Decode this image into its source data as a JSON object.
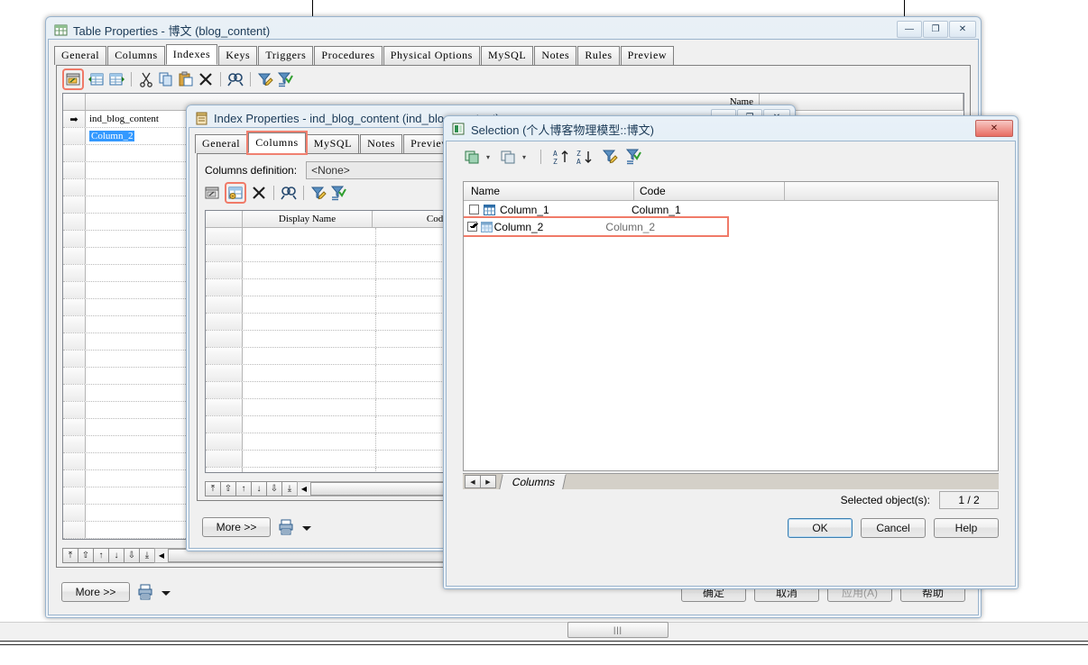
{
  "table_properties": {
    "title": "Table Properties - 博文 (blog_content)",
    "window_icon": "table-icon",
    "buttons": {
      "minimize": "—",
      "maximize": "❐",
      "close": "✕"
    },
    "tabs": [
      {
        "label": "General",
        "active": false
      },
      {
        "label": "Columns",
        "active": false
      },
      {
        "label": "Indexes",
        "active": true
      },
      {
        "label": "Keys",
        "active": false
      },
      {
        "label": "Triggers",
        "active": false
      },
      {
        "label": "Procedures",
        "active": false
      },
      {
        "label": "Physical Options",
        "active": false
      },
      {
        "label": "MySQL",
        "active": false
      },
      {
        "label": "Notes",
        "active": false
      },
      {
        "label": "Rules",
        "active": false
      },
      {
        "label": "Preview",
        "active": false
      }
    ],
    "toolbar": [
      {
        "name": "properties-icon",
        "highlighted": true
      },
      {
        "name": "insert-row-icon",
        "highlighted": false
      },
      {
        "name": "add-row-icon",
        "highlighted": false
      },
      {
        "name": "cut-icon",
        "highlighted": false
      },
      {
        "name": "copy-icon",
        "highlighted": false
      },
      {
        "name": "paste-icon",
        "highlighted": false
      },
      {
        "name": "delete-icon",
        "highlighted": false
      },
      {
        "name": "find-icon",
        "highlighted": false
      },
      {
        "name": "filter-edit-icon",
        "highlighted": false
      },
      {
        "name": "filter-apply-icon",
        "highlighted": false
      }
    ],
    "grid": {
      "columns": [
        "Name"
      ],
      "rows": [
        {
          "marker": "➡",
          "name": "ind_blog_content"
        },
        {
          "marker": "",
          "name": ""
        },
        {
          "marker": "",
          "name": ""
        },
        {
          "marker": "",
          "name": ""
        },
        {
          "marker": "",
          "name": ""
        },
        {
          "marker": "",
          "name": ""
        },
        {
          "marker": "",
          "name": ""
        },
        {
          "marker": "",
          "name": ""
        },
        {
          "marker": "",
          "name": ""
        },
        {
          "marker": "",
          "name": ""
        },
        {
          "marker": "",
          "name": ""
        },
        {
          "marker": "",
          "name": ""
        },
        {
          "marker": "",
          "name": ""
        },
        {
          "marker": "",
          "name": ""
        },
        {
          "marker": "",
          "name": ""
        },
        {
          "marker": "",
          "name": ""
        },
        {
          "marker": "",
          "name": ""
        },
        {
          "marker": "",
          "name": ""
        },
        {
          "marker": "",
          "name": ""
        },
        {
          "marker": "",
          "name": ""
        },
        {
          "marker": "",
          "name": ""
        },
        {
          "marker": "",
          "name": ""
        },
        {
          "marker": "",
          "name": ""
        },
        {
          "marker": "",
          "name": ""
        },
        {
          "marker": "",
          "name": ""
        },
        {
          "marker": "",
          "name": ""
        }
      ]
    },
    "row_nav": [
      "⤒",
      "⇧",
      "↑",
      "↓",
      "⇩",
      "⤓"
    ],
    "more_button": "More >>",
    "print_icon": "print-icon",
    "dropdown_icon": "chevron-down-icon",
    "footer_buttons": [
      {
        "label": "确定",
        "disabled": false,
        "default": false
      },
      {
        "label": "取消",
        "disabled": false,
        "default": false
      },
      {
        "label": "应用(A)",
        "disabled": true,
        "default": false
      },
      {
        "label": "帮助",
        "disabled": false,
        "default": false
      }
    ]
  },
  "index_properties": {
    "title": "Index Properties - ind_blog_content (ind_blog_content)",
    "window_icon": "index-icon",
    "buttons": {
      "minimize": "—",
      "maximize": "❐",
      "close": "✕"
    },
    "tabs": [
      {
        "label": "General",
        "active": false,
        "highlighted": false
      },
      {
        "label": "Columns",
        "active": true,
        "highlighted": true
      },
      {
        "label": "MySQL",
        "active": false,
        "highlighted": false
      },
      {
        "label": "Notes",
        "active": false,
        "highlighted": false
      },
      {
        "label": "Preview",
        "active": false,
        "highlighted": false
      }
    ],
    "columns_definition_label": "Columns definition:",
    "columns_definition_value": "<None>",
    "toolbar": [
      {
        "name": "properties-icon",
        "highlighted": false
      },
      {
        "name": "add-columns-icon",
        "highlighted": true
      },
      {
        "name": "delete-icon",
        "highlighted": false
      },
      {
        "name": "find-icon",
        "highlighted": false
      },
      {
        "name": "filter-edit-icon",
        "highlighted": false
      },
      {
        "name": "filter-apply-icon",
        "highlighted": false
      }
    ],
    "grid": {
      "columns": [
        "Display Name",
        "Code"
      ],
      "row_count": 15
    },
    "row_nav": [
      "⤒",
      "⇧",
      "↑",
      "↓",
      "⇩",
      "⤓"
    ],
    "more_button": "More >>",
    "print_icon": "print-icon",
    "dropdown_icon": "chevron-down-icon"
  },
  "selection_dialog": {
    "title": "Selection (个人博客物理模型::博文)",
    "window_icon": "selection-icon",
    "close_button": "✕",
    "toolbar": [
      {
        "name": "select-all-icon",
        "has_dropdown": true
      },
      {
        "name": "deselect-all-icon",
        "has_dropdown": true
      },
      {
        "name": "sort-ascending-icon",
        "has_dropdown": false
      },
      {
        "name": "sort-descending-icon",
        "has_dropdown": false
      },
      {
        "name": "filter-edit-icon",
        "has_dropdown": false
      },
      {
        "name": "filter-apply-icon",
        "has_dropdown": false
      }
    ],
    "grid": {
      "columns": [
        "Name",
        "Code",
        ""
      ],
      "rows": [
        {
          "checked": false,
          "icon": "column-icon",
          "name": "Column_1",
          "code": "Column_1",
          "selected": false,
          "highlighted": false
        },
        {
          "checked": true,
          "icon": "column-icon",
          "name": "Column_2",
          "code": "Column_2",
          "selected": true,
          "highlighted": true
        }
      ]
    },
    "sheet_nav": {
      "prev": "◀",
      "next": "▶"
    },
    "sheet_tab": "Columns",
    "status_label": "Selected object(s):",
    "status_value": "1 / 2",
    "buttons": [
      {
        "label": "OK",
        "default": true
      },
      {
        "label": "Cancel",
        "default": false
      },
      {
        "label": "Help",
        "default": false
      }
    ]
  },
  "desktop": {
    "taskbar_thumb": "|||"
  },
  "colors": {
    "highlight_red": "#f07a68",
    "selection_blue": "#3399ff",
    "title_blue": "#1b3a57",
    "window_frame": "#9ab4cd"
  }
}
